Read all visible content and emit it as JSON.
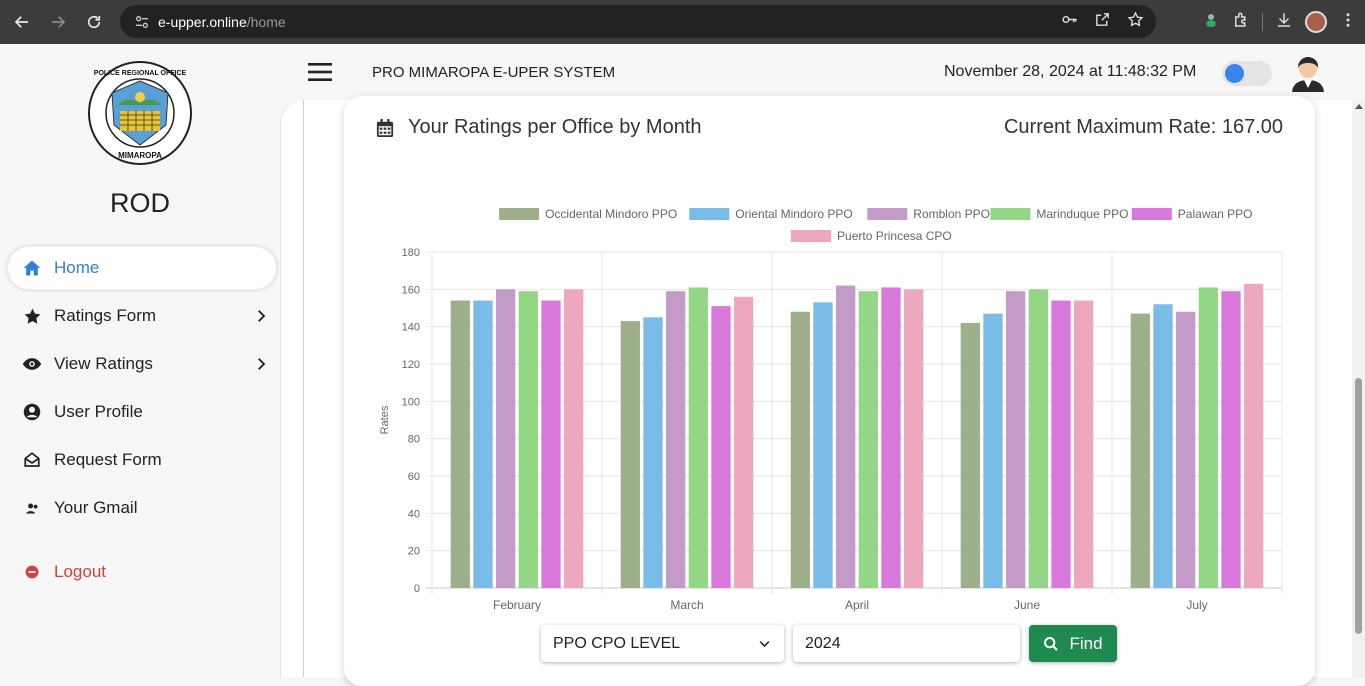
{
  "browser": {
    "url_host": "e-upper.online",
    "url_path": "/home"
  },
  "sidebar": {
    "org_name": "ROD",
    "logo_icon": "police-regional-office-mimaropa-seal",
    "items": [
      {
        "label": "Home",
        "icon": "home-icon",
        "active": true
      },
      {
        "label": "Ratings Form",
        "icon": "star-icon",
        "has_submenu": true
      },
      {
        "label": "View Ratings",
        "icon": "eye-icon",
        "has_submenu": true
      },
      {
        "label": "User Profile",
        "icon": "user-circle-icon"
      },
      {
        "label": "Request Form",
        "icon": "envelope-open-icon"
      },
      {
        "label": "Your Gmail",
        "icon": "user-group-icon"
      }
    ],
    "logout_label": "Logout"
  },
  "topbar": {
    "system_title": "PRO MIMAROPA E-UPER SYSTEM",
    "datetime": "November 28, 2024 at 11:48:32 PM",
    "theme_toggle_on": true
  },
  "card": {
    "title": "Your Ratings per Office by Month",
    "max_rate_label": "Current Maximum Rate: 167.00"
  },
  "controls": {
    "level_select": "PPO CPO LEVEL",
    "year_value": "2024",
    "find_label": "Find"
  },
  "colors": {
    "accent": "#2f7fd9",
    "find_button": "#1f8a4f",
    "logout": "#d2423c"
  },
  "chart_data": {
    "type": "bar",
    "categories": [
      "February",
      "March",
      "April",
      "June",
      "July"
    ],
    "ylabel": "Rates",
    "xlabel": "",
    "ylim": [
      0,
      180
    ],
    "ytick_step": 20,
    "grid": true,
    "legend_position": "top",
    "series": [
      {
        "name": "Occidental Mindoro PPO",
        "color": "#9db08b",
        "values": [
          154,
          143,
          148,
          142,
          147
        ]
      },
      {
        "name": "Oriental Mindoro PPO",
        "color": "#7abce8",
        "values": [
          154,
          145,
          153,
          147,
          152
        ]
      },
      {
        "name": "Romblon PPO",
        "color": "#c39ac8",
        "values": [
          160,
          159,
          162,
          159,
          148
        ]
      },
      {
        "name": "Marinduque PPO",
        "color": "#93d685",
        "values": [
          159,
          161,
          159,
          160,
          161
        ]
      },
      {
        "name": "Palawan PPO",
        "color": "#d878da",
        "values": [
          154,
          151,
          161,
          154,
          159
        ]
      },
      {
        "name": "Puerto Princesa CPO",
        "color": "#eea8bd",
        "values": [
          160,
          156,
          160,
          154,
          163
        ]
      }
    ]
  }
}
